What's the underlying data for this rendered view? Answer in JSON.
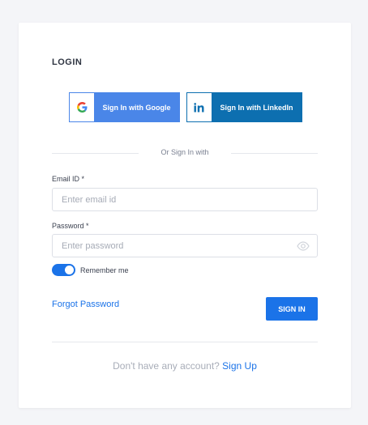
{
  "login": {
    "title": "LOGIN",
    "google_label": "Sign In with Google",
    "linkedin_label": "Sign In with LinkedIn",
    "divider_text": "Or Sign In with",
    "email_label": "Email ID *",
    "email_placeholder": "Enter email id",
    "password_label": "Password *",
    "password_placeholder": "Enter password",
    "remember_label": "Remember me",
    "forgot_label": "Forgot Password",
    "signin_label": "SIGN IN",
    "footer_text": "Don't have any account?",
    "signup_label": "Sign Up"
  },
  "colors": {
    "primary": "#1b73e8",
    "google_blue": "#4a86e8",
    "linkedin_blue": "#0d6fb0",
    "background": "#f4f5f8"
  },
  "icons": [
    "google-icon",
    "linkedin-icon",
    "eye-icon"
  ],
  "state": {
    "remember_me": true
  }
}
